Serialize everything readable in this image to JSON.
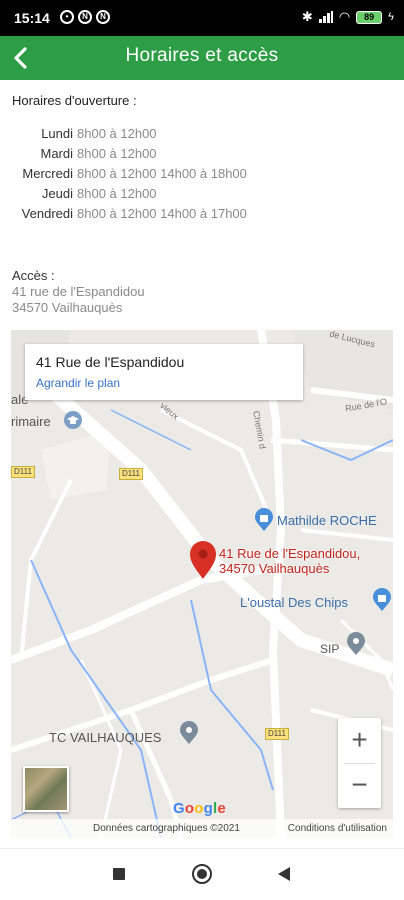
{
  "status_bar": {
    "time": "15:14",
    "battery": "89"
  },
  "app_bar": {
    "title": "Horaires et accès",
    "back_icon": "arrow-left-icon"
  },
  "hours": {
    "heading": "Horaires d'ouverture :",
    "rows": [
      {
        "day": "Lundi",
        "time": "8h00 à 12h00"
      },
      {
        "day": "Mardi",
        "time": "8h00 à 12h00"
      },
      {
        "day": "Mercredi",
        "time": "8h00 à 12h00 14h00 à 18h00"
      },
      {
        "day": "Jeudi",
        "time": "8h00 à 12h00"
      },
      {
        "day": "Vendredi",
        "time": "8h00 à 12h00 14h00 à 17h00"
      }
    ]
  },
  "access": {
    "label": "Accès :",
    "line1": "41 rue de l'Espandidou",
    "line2": "34570 Vailhauquès"
  },
  "map": {
    "card_title": "41 Rue de l'Espandidou",
    "card_link": "Agrandir le plan",
    "pin_label_line1": "41 Rue de l'Espandidou,",
    "pin_label_line2": "34570 Vailhauquès",
    "poi_mathilde": "Mathilde ROCHE",
    "poi_oustal": "L'oustal Des Chips",
    "poi_sip": "SIP",
    "poi_tc": "TC VAILHAUQUES",
    "poi_primaire": "rimaire",
    "label_ale": "ale",
    "label_lucques": "de Lucques",
    "label_rue_de": "Rue de l'O",
    "label_chemin": "Chemin d",
    "label_vieux": "vieux",
    "road_d111_a": "D111",
    "road_d111_b": "D111",
    "road_d111_c": "D111",
    "zoom_in": "+",
    "zoom_out": "−",
    "credit": "Données cartographiques ©2021",
    "terms": "Conditions d'utilisation"
  },
  "colors": {
    "app_bar": "#2e9e46",
    "pin": "#d93025",
    "link": "#3a73c7"
  }
}
